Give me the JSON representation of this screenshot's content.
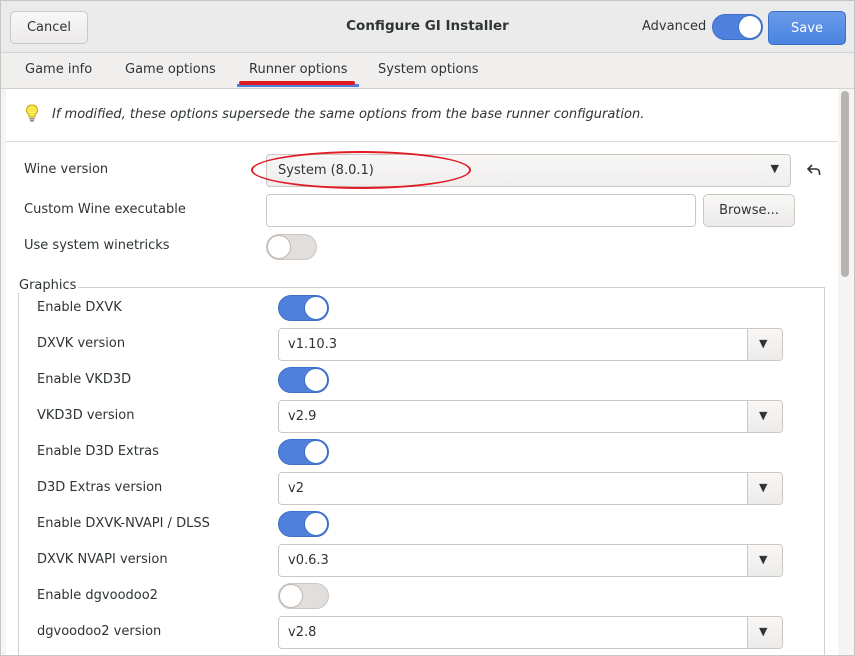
{
  "window": {
    "title": "Configure GI Installer"
  },
  "header": {
    "cancel_label": "Cancel",
    "advanced_label": "Advanced",
    "advanced_on": true,
    "save_label": "Save"
  },
  "tabs": [
    {
      "label": "Game info",
      "active": false
    },
    {
      "label": "Game options",
      "active": false
    },
    {
      "label": "Runner options",
      "active": true
    },
    {
      "label": "System options",
      "active": false
    }
  ],
  "info": {
    "icon": "lightbulb-icon",
    "text": "If modified, these options supersede the same options from the base runner configuration."
  },
  "runner": {
    "wine_version_label": "Wine version",
    "wine_version_value": "System (8.0.1)",
    "custom_wine_label": "Custom Wine executable",
    "custom_wine_value": "",
    "browse_label": "Browse...",
    "winetricks_label": "Use system winetricks",
    "winetricks_on": false
  },
  "graphics": {
    "section_label": "Graphics",
    "rows": [
      {
        "label": "Enable DXVK",
        "type": "switch",
        "on": true
      },
      {
        "label": "DXVK version",
        "type": "combo",
        "value": "v1.10.3"
      },
      {
        "label": "Enable VKD3D",
        "type": "switch",
        "on": true
      },
      {
        "label": "VKD3D version",
        "type": "combo",
        "value": "v2.9"
      },
      {
        "label": "Enable D3D Extras",
        "type": "switch",
        "on": true
      },
      {
        "label": "D3D Extras version",
        "type": "combo",
        "value": "v2"
      },
      {
        "label": "Enable DXVK-NVAPI / DLSS",
        "type": "switch",
        "on": true
      },
      {
        "label": "DXVK NVAPI version",
        "type": "combo",
        "value": "v0.6.3"
      },
      {
        "label": "Enable dgvoodoo2",
        "type": "switch",
        "on": false
      },
      {
        "label": "dgvoodoo2 version",
        "type": "combo",
        "value": "v2.8"
      }
    ]
  },
  "colors": {
    "accent": "#4f80dc",
    "annotation_red": "#e01b24"
  }
}
